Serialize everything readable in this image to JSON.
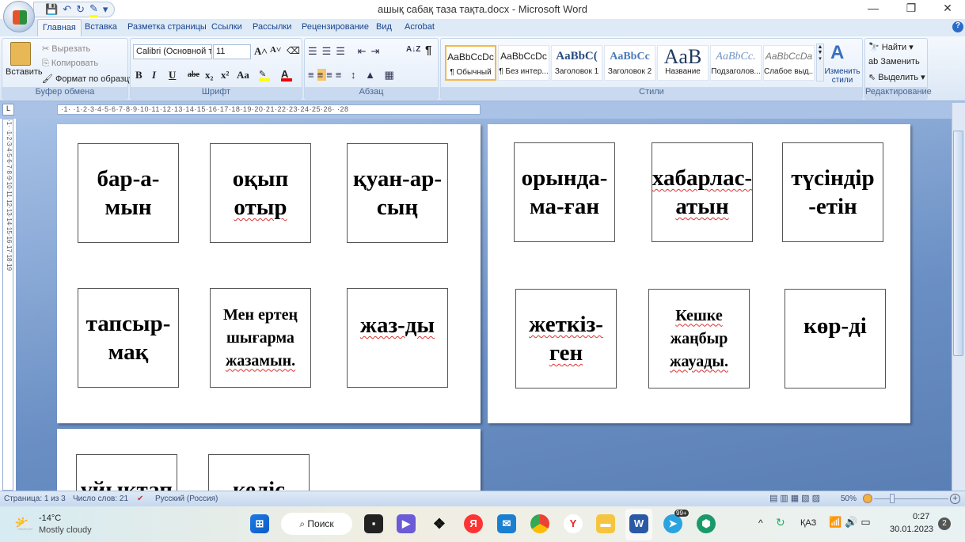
{
  "window": {
    "title": "ашық сабақ таза тақта.docx - Microsoft Word",
    "minimize": "—",
    "restore": "❐",
    "close": "✕"
  },
  "qat": {
    "save": "💾",
    "undo": "↶",
    "redo": "↻",
    "highlight": "✎",
    "more": "▾"
  },
  "tabs": [
    "Главная",
    "Вставка",
    "Разметка страницы",
    "Ссылки",
    "Рассылки",
    "Рецензирование",
    "Вид",
    "Acrobat"
  ],
  "ribbon": {
    "clipboard": {
      "paste": "Вставить",
      "cut": "Вырезать",
      "copy": "Копировать",
      "format_painter": "Формат по образцу",
      "label": "Буфер обмена"
    },
    "font": {
      "name": "Calibri (Основной те",
      "size": "11",
      "label": "Шрифт",
      "bold": "B",
      "italic": "I",
      "underline": "U",
      "strike": "abe",
      "sub": "x₂",
      "sup": "x²",
      "case": "Aa",
      "grow": "A˄",
      "shrink": "A˅"
    },
    "paragraph": {
      "label": "Абзац",
      "pilcrow": "¶",
      "sort": "A↓Z"
    },
    "styles": {
      "label": "Стили",
      "items": [
        {
          "preview": "AaBbCcDc",
          "name": "¶ Обычный"
        },
        {
          "preview": "AaBbCcDc",
          "name": "¶ Без интер..."
        },
        {
          "preview": "AaBbC(",
          "name": "Заголовок 1"
        },
        {
          "preview": "AaBbCc",
          "name": "Заголовок 2"
        },
        {
          "preview": "AaB",
          "name": "Название"
        },
        {
          "preview": "AaBbCc.",
          "name": "Подзаголов..."
        },
        {
          "preview": "AaBbCcDa",
          "name": "Слабое выд..."
        }
      ],
      "change": "Изменить стили"
    },
    "editing": {
      "label": "Редактирование",
      "find": "Найти",
      "replace": "Заменить",
      "select": "Выделить"
    }
  },
  "ruler": {
    "h": "·1·  ·1·2·3·4·5·6·7·8·9·10·11·12·13·14·15·16·17·18·19·20·21·22·23·24·25·26·  ·28",
    "v": "·1·  ·1·2·3·4·5·6·7·8·9·10·11·12·13·14·15·16·17·18·19"
  },
  "pages": {
    "p1": [
      [
        "бар-а-",
        "мын"
      ],
      [
        "оқып",
        "отыр"
      ],
      [
        "қуан-ар-",
        "сың"
      ],
      [
        "тапсыр-",
        "мақ"
      ],
      [
        "Мен ертең",
        "шығарма",
        "жазамын."
      ],
      [
        "жаз-ды"
      ]
    ],
    "p2": [
      [
        "орында-",
        "ма-ған"
      ],
      [
        "хабарлас-",
        "атын"
      ],
      [
        "түсіндір",
        "-етін"
      ],
      [
        "жеткіз-",
        "ген"
      ],
      [
        "Кешке",
        "жаңбыр",
        "жауады."
      ],
      [
        "көр-ді"
      ]
    ],
    "p3": [
      [
        "үйықтап"
      ],
      [
        "келіс"
      ]
    ]
  },
  "status": {
    "page": "Страница: 1 из 3",
    "words": "Число слов: 21",
    "lang": "Русский (Россия)",
    "zoom": "50%"
  },
  "taskbar": {
    "temp": "-14°C",
    "weather": "Mostly cloudy",
    "search": "Поиск",
    "lang": "ҚАЗ",
    "time": "0:27",
    "date": "30.01.2023",
    "badge": "2",
    "telegram_badge": "99+"
  }
}
